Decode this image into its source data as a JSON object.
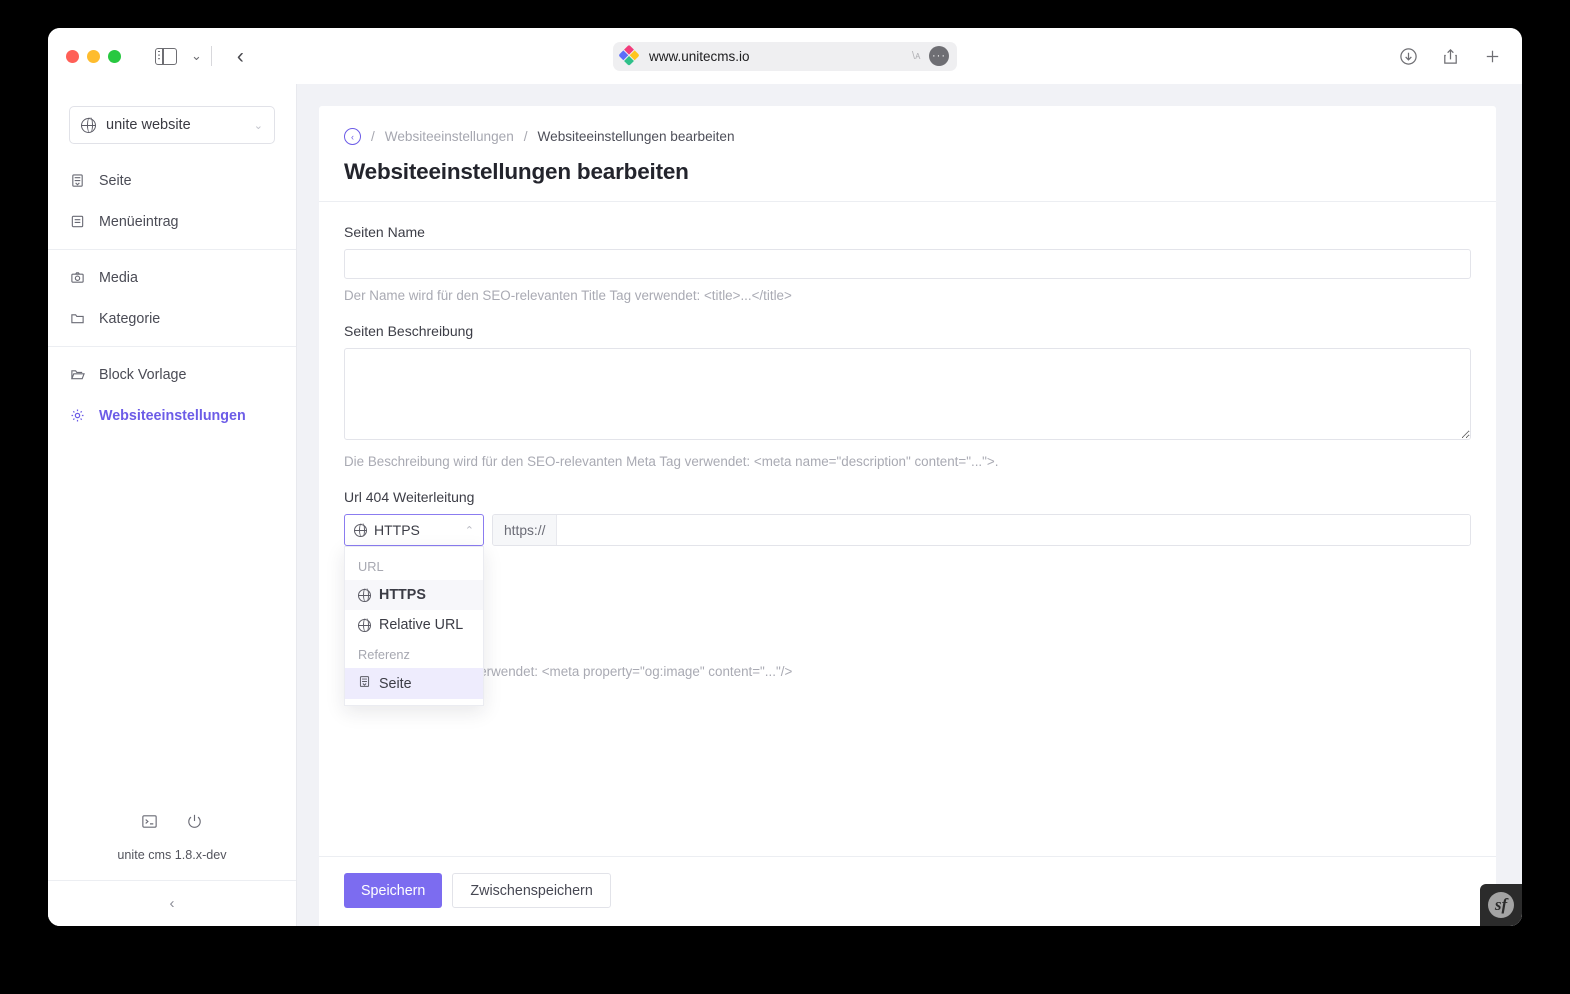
{
  "browser": {
    "url": "www.unitecms.io",
    "reader_glyph": "ᴀ/",
    "icons": {
      "sidebar": "sidebar-toggle-icon",
      "tab_overview": "chevron-down-icon",
      "back": "back-chevron-icon",
      "download": "download-icon",
      "share": "share-icon",
      "new_tab": "plus-icon"
    }
  },
  "sidebar": {
    "site_selector": {
      "label": "unite website",
      "icon": "globe-icon",
      "chevron": "chevron-down-icon"
    },
    "items": [
      {
        "label": "Seite",
        "icon": "page-icon",
        "active": false,
        "sep_after": false
      },
      {
        "label": "Menüeintrag",
        "icon": "menu-entry-icon",
        "active": false,
        "sep_after": true
      },
      {
        "label": "Media",
        "icon": "camera-icon",
        "active": false,
        "sep_after": false
      },
      {
        "label": "Kategorie",
        "icon": "folder-icon",
        "active": false,
        "sep_after": true
      },
      {
        "label": "Block Vorlage",
        "icon": "folder-open-icon",
        "active": false,
        "sep_after": false
      },
      {
        "label": "Websiteeinstellungen",
        "icon": "gear-icon",
        "active": true,
        "sep_after": false
      }
    ],
    "footer": {
      "terminal_icon": "terminal-icon",
      "power_icon": "power-icon",
      "version": "unite cms 1.8.x-dev",
      "collapse_icon": "chevron-left-icon"
    }
  },
  "breadcrumb": {
    "back_icon": "back-circle-icon",
    "sep": "/",
    "parent": "Websiteeinstellungen",
    "current": "Websiteeinstellungen bearbeiten"
  },
  "page": {
    "title": "Websiteeinstellungen bearbeiten"
  },
  "form": {
    "name": {
      "label": "Seiten Name",
      "value": "",
      "placeholder": "",
      "help": "Der Name wird für den SEO-relevanten Title Tag verwendet: <title>...</title>"
    },
    "description": {
      "label": "Seiten Beschreibung",
      "value": "",
      "placeholder": "",
      "help": "Die Beschreibung wird für den SEO-relevanten Meta Tag verwendet: <meta name=\"description\" content=\"...\">."
    },
    "redirect": {
      "label": "Url 404 Weiterleitung",
      "select_value": "HTTPS",
      "select_icon": "globe-icon",
      "select_chevron": "chevron-up-icon",
      "prefix": "https://",
      "value": "",
      "placeholder": ""
    },
    "image_help": "-relevante Meta Tags verwendet: <meta property=\"og:image\" content=\"...\"/>"
  },
  "dropdown": {
    "groups": [
      {
        "title": "URL",
        "options": [
          {
            "label": "HTTPS",
            "icon": "globe-icon",
            "state": "selected"
          },
          {
            "label": "Relative URL",
            "icon": "globe-icon",
            "state": "normal"
          }
        ]
      },
      {
        "title": "Referenz",
        "options": [
          {
            "label": "Seite",
            "icon": "page-icon",
            "state": "hover"
          }
        ]
      }
    ]
  },
  "actions": {
    "save": "Speichern",
    "draft": "Zwischenspeichern"
  },
  "profiler": {
    "label": "sf"
  },
  "colors": {
    "accent": "#7c6cf0",
    "accent_text": "#6c5ce7",
    "page_bg": "#f1f2f6",
    "border": "#e3e4ea",
    "muted_text": "#a9aab3"
  }
}
